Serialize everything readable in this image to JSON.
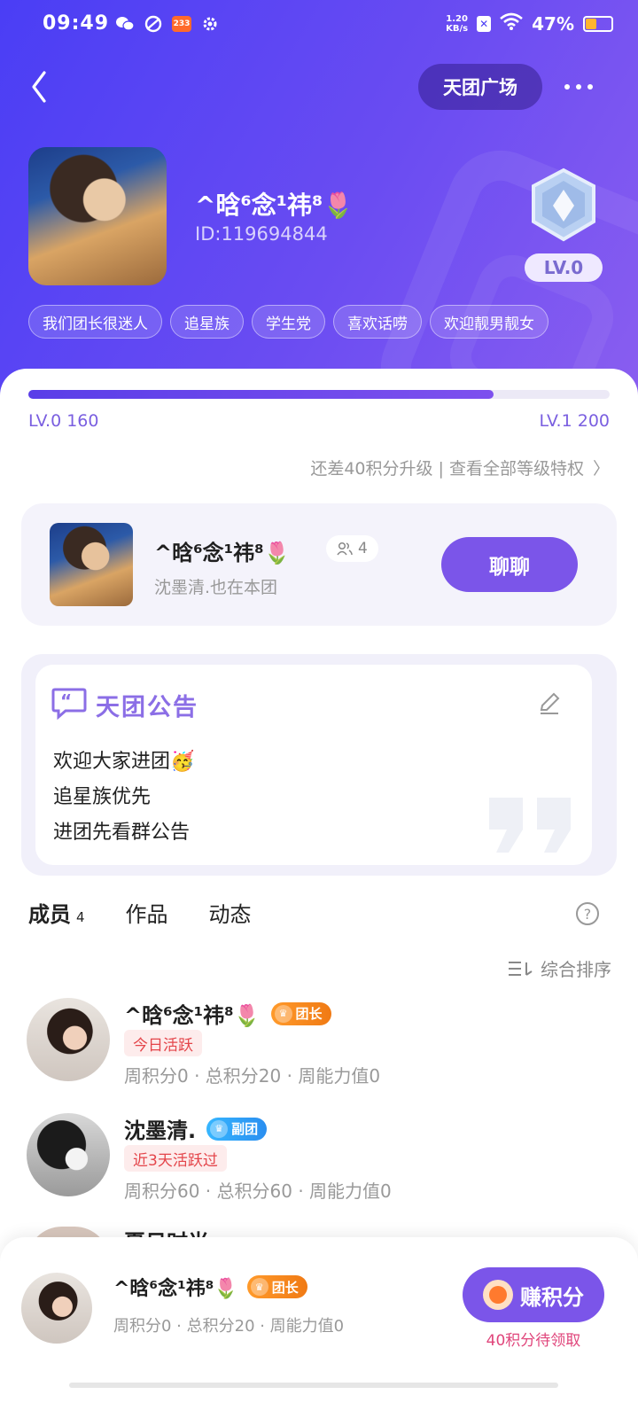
{
  "status_bar": {
    "time": "09:49",
    "speed_top": "1.20",
    "speed_unit": "KB/s",
    "badge_233": "233",
    "battery": "47%",
    "battery_level": 0.47
  },
  "header": {
    "plaza_label": "天团广场",
    "back_icon": "chevron-left-icon",
    "more_icon": "more-dots-icon"
  },
  "group": {
    "name": "^晗⁶念¹祎⁸🌷",
    "id": "ID:119694844",
    "level": "LV.0",
    "tags": [
      "我们团长很迷人",
      "追星族",
      "学生党",
      "喜欢话唠",
      "欢迎靓男靓女"
    ]
  },
  "progress": {
    "fraction": 0.8,
    "left_label": "LV.0 160",
    "right_label": "LV.1 200",
    "upgrade_text": "还差40积分升级 | 查看全部等级特权",
    "chevron": "〉"
  },
  "owner_card": {
    "name": "^晗⁶念¹祎⁸🌷",
    "member_count": "4",
    "subtitle": "沈墨清.也在本团",
    "chat_label": "聊聊"
  },
  "notice": {
    "title": "天团公告",
    "lines": [
      "欢迎大家进团🥳",
      "追星族优先",
      "进团先看群公告"
    ]
  },
  "tabs": [
    {
      "label": "成员",
      "count": "4"
    },
    {
      "label": "作品"
    },
    {
      "label": "动态"
    }
  ],
  "sort_label": "综合排序",
  "members": [
    {
      "name": "^晗⁶念¹祎⁸🌷",
      "role": "团长",
      "active": "今日活跃",
      "stats": "周积分0 · 总积分20 · 周能力值0"
    },
    {
      "name": "沈墨清.",
      "role": "副团",
      "active": "近3天活跃过",
      "stats": "周积分60 · 总积分60 · 周能力值0"
    },
    {
      "name": "夏日时光"
    }
  ],
  "bottom_bar": {
    "name": "^晗⁶念¹祎⁸🌷",
    "role": "团长",
    "stats": "周积分0 · 总积分20 · 周能力值0",
    "earn_label": "赚积分",
    "earn_sub": "40积分待领取"
  },
  "colors": {
    "accent": "#7b55e9",
    "hero": "#4a3ef5",
    "owner_badge": "#f07a14",
    "vice_badge": "#2a8ef0",
    "active_red": "#e4454a"
  }
}
